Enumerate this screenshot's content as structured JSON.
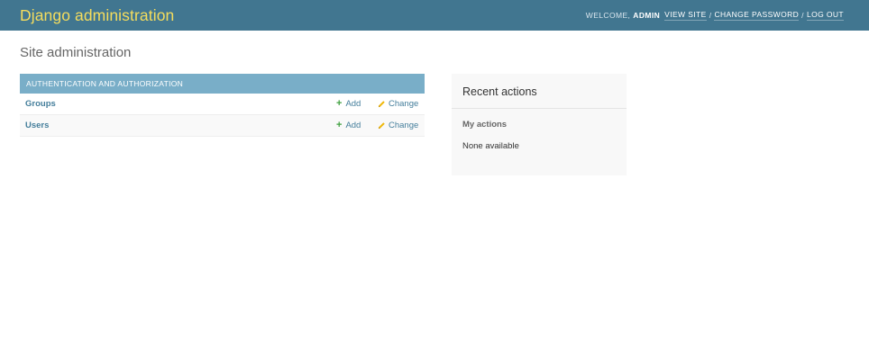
{
  "header": {
    "branding": "Django administration",
    "welcome_text": "WELCOME,",
    "username": "ADMIN",
    "links": {
      "view_site": "VIEW SITE",
      "change_password": "CHANGE PASSWORD",
      "log_out": "LOG OUT"
    },
    "separator": "/"
  },
  "main": {
    "title": "Site administration",
    "app_module": {
      "caption": "AUTHENTICATION AND AUTHORIZATION",
      "models": [
        {
          "name": "Groups",
          "add_label": "Add",
          "change_label": "Change"
        },
        {
          "name": "Users",
          "add_label": "Add",
          "change_label": "Change"
        }
      ]
    }
  },
  "sidebar": {
    "recent_actions_title": "Recent actions",
    "my_actions_title": "My actions",
    "empty_text": "None available"
  },
  "colors": {
    "header_bg": "#417690",
    "branding": "#f5dd5d",
    "caption_bg": "#79aec8",
    "link": "#447e9b",
    "add_icon": "#41a141",
    "change_icon": "#efb80b"
  },
  "icons": {
    "add": "plus-icon",
    "change": "pencil-icon"
  }
}
